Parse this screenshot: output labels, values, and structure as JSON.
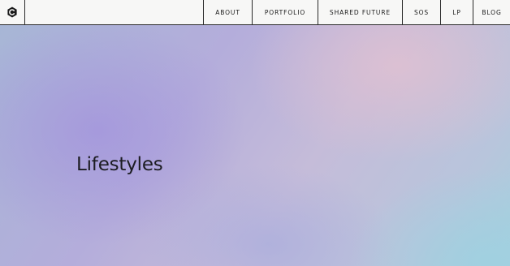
{
  "header": {
    "logo_icon": "hexagon-c-logo-icon",
    "nav": [
      {
        "label": "ABOUT"
      },
      {
        "label": "PORTFOLIO"
      },
      {
        "label": "SHARED FUTURE"
      },
      {
        "label": "SOS"
      },
      {
        "label": "LP"
      },
      {
        "label": "BLOG"
      }
    ]
  },
  "hero": {
    "title": "Lifestyles"
  },
  "colors": {
    "header_bg": "#f7f7f6",
    "divider": "#2a2a2a",
    "text": "#1c1c22",
    "gradient_violet": "#a496dc",
    "gradient_pink": "#dec0d2",
    "gradient_cyan": "#a0d0e0"
  }
}
